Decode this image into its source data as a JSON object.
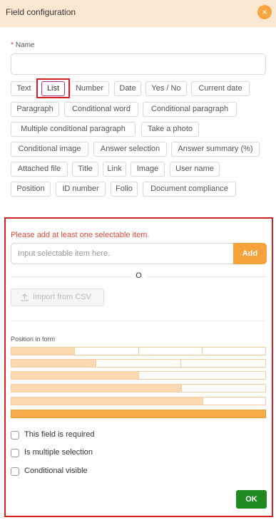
{
  "header": {
    "title": "Field configuration",
    "close_glyph": "×"
  },
  "name_field": {
    "required_mark": "*",
    "label": "Name",
    "value": "",
    "placeholder": ""
  },
  "field_types": [
    {
      "label": "Text",
      "selected": false
    },
    {
      "label": "List",
      "selected": true
    },
    {
      "label": "Number",
      "selected": false
    },
    {
      "label": "Date",
      "selected": false
    },
    {
      "label": "Yes / No",
      "selected": false
    },
    {
      "label": "Current date",
      "selected": false
    },
    {
      "label": "Paragraph",
      "selected": false
    },
    {
      "label": "Conditional word",
      "selected": false
    },
    {
      "label": "Conditional paragraph",
      "selected": false
    },
    {
      "label": "Multiple conditional paragraph",
      "selected": false
    },
    {
      "label": "Take a photo",
      "selected": false
    },
    {
      "label": "Conditional image",
      "selected": false
    },
    {
      "label": "Answer selection",
      "selected": false
    },
    {
      "label": "Answer summary (%)",
      "selected": false
    },
    {
      "label": "Attached file",
      "selected": false
    },
    {
      "label": "Title",
      "selected": false
    },
    {
      "label": "Link",
      "selected": false
    },
    {
      "label": "Image",
      "selected": false
    },
    {
      "label": "User name",
      "selected": false
    },
    {
      "label": "Position",
      "selected": false
    },
    {
      "label": "ID number",
      "selected": false
    },
    {
      "label": "Folio",
      "selected": false
    },
    {
      "label": "Document compliance",
      "selected": false
    }
  ],
  "list_config": {
    "warning": "Please add at least one selectable item.",
    "item_input_placeholder": "Input selectable item here.",
    "add_label": "Add",
    "or_label": "O",
    "import_label": "Import from CSV",
    "import_icon": "upload-icon"
  },
  "position": {
    "label": "Position in form",
    "rows": [
      {
        "filled_fraction": 0.25
      },
      {
        "filled_fraction": 0.333
      },
      {
        "filled_fraction": 0.5
      },
      {
        "filled_fraction": 0.667
      },
      {
        "filled_fraction": 0.75
      },
      {
        "filled_fraction": 1.0
      }
    ]
  },
  "options": [
    {
      "label": "This field is required",
      "checked": false
    },
    {
      "label": "Is multiple selection",
      "checked": false
    },
    {
      "label": "Conditional visible",
      "checked": false
    }
  ],
  "ok_label": "OK",
  "colors": {
    "accent": "#f6a23c",
    "header_bg": "#fbe8d3",
    "ok": "#1f8a1f",
    "warning": "#e24a3a",
    "highlight": "#d42020"
  }
}
